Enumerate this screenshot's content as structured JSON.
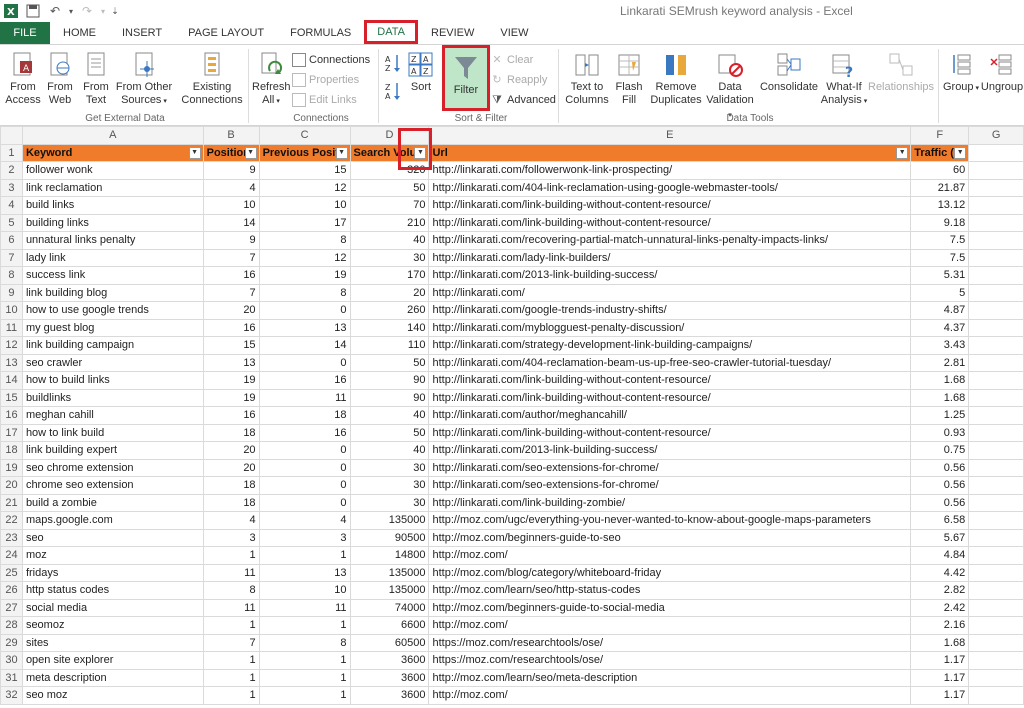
{
  "window": {
    "title": "Linkarati SEMrush keyword analysis - Excel"
  },
  "tabs": [
    "FILE",
    "HOME",
    "INSERT",
    "PAGE LAYOUT",
    "FORMULAS",
    "DATA",
    "REVIEW",
    "VIEW"
  ],
  "active_tab": "DATA",
  "ribbon": {
    "get_external": {
      "label": "Get External Data",
      "from_access": "From\nAccess",
      "from_web": "From\nWeb",
      "from_text": "From\nText",
      "from_other": "From Other\nSources",
      "existing": "Existing\nConnections"
    },
    "connections": {
      "label": "Connections",
      "refresh": "Refresh\nAll",
      "connections": "Connections",
      "properties": "Properties",
      "edit_links": "Edit Links"
    },
    "sort_filter": {
      "label": "Sort & Filter",
      "sort": "Sort",
      "filter": "Filter",
      "clear": "Clear",
      "reapply": "Reapply",
      "advanced": "Advanced"
    },
    "data_tools": {
      "label": "Data Tools",
      "text_to_columns": "Text to\nColumns",
      "flash_fill": "Flash\nFill",
      "remove_duplicates": "Remove\nDuplicates",
      "data_validation": "Data\nValidation",
      "consolidate": "Consolidate",
      "what_if": "What-If\nAnalysis",
      "relationships": "Relationships"
    },
    "outline": {
      "group": "Group",
      "ungroup": "Ungroup"
    }
  },
  "sheet": {
    "columns": [
      "A",
      "B",
      "C",
      "D",
      "E",
      "F",
      "G"
    ],
    "headers": [
      "Keyword",
      "Position",
      "Previous Positi",
      "Search Volu",
      "Url",
      "Traffic (%"
    ],
    "rows": [
      [
        "follower wonk",
        "9",
        "15",
        "320",
        "http://linkarati.com/followerwonk-link-prospecting/",
        "60"
      ],
      [
        "link reclamation",
        "4",
        "12",
        "50",
        "http://linkarati.com/404-link-reclamation-using-google-webmaster-tools/",
        "21.87"
      ],
      [
        "build links",
        "10",
        "10",
        "70",
        "http://linkarati.com/link-building-without-content-resource/",
        "13.12"
      ],
      [
        "building links",
        "14",
        "17",
        "210",
        "http://linkarati.com/link-building-without-content-resource/",
        "9.18"
      ],
      [
        "unnatural links penalty",
        "9",
        "8",
        "40",
        "http://linkarati.com/recovering-partial-match-unnatural-links-penalty-impacts-links/",
        "7.5"
      ],
      [
        "lady link",
        "7",
        "12",
        "30",
        "http://linkarati.com/lady-link-builders/",
        "7.5"
      ],
      [
        "success link",
        "16",
        "19",
        "170",
        "http://linkarati.com/2013-link-building-success/",
        "5.31"
      ],
      [
        "link building blog",
        "7",
        "8",
        "20",
        "http://linkarati.com/",
        "5"
      ],
      [
        "how to use google trends",
        "20",
        "0",
        "260",
        "http://linkarati.com/google-trends-industry-shifts/",
        "4.87"
      ],
      [
        "my guest blog",
        "16",
        "13",
        "140",
        "http://linkarati.com/myblogguest-penalty-discussion/",
        "4.37"
      ],
      [
        "link building campaign",
        "15",
        "14",
        "110",
        "http://linkarati.com/strategy-development-link-building-campaigns/",
        "3.43"
      ],
      [
        "seo crawler",
        "13",
        "0",
        "50",
        "http://linkarati.com/404-reclamation-beam-us-up-free-seo-crawler-tutorial-tuesday/",
        "2.81"
      ],
      [
        "how to build links",
        "19",
        "16",
        "90",
        "http://linkarati.com/link-building-without-content-resource/",
        "1.68"
      ],
      [
        "buildlinks",
        "19",
        "11",
        "90",
        "http://linkarati.com/link-building-without-content-resource/",
        "1.68"
      ],
      [
        "meghan cahill",
        "16",
        "18",
        "40",
        "http://linkarati.com/author/meghancahill/",
        "1.25"
      ],
      [
        "how to link build",
        "18",
        "16",
        "50",
        "http://linkarati.com/link-building-without-content-resource/",
        "0.93"
      ],
      [
        "link building expert",
        "20",
        "0",
        "40",
        "http://linkarati.com/2013-link-building-success/",
        "0.75"
      ],
      [
        "seo chrome extension",
        "20",
        "0",
        "30",
        "http://linkarati.com/seo-extensions-for-chrome/",
        "0.56"
      ],
      [
        "chrome seo extension",
        "18",
        "0",
        "30",
        "http://linkarati.com/seo-extensions-for-chrome/",
        "0.56"
      ],
      [
        "build a zombie",
        "18",
        "0",
        "30",
        "http://linkarati.com/link-building-zombie/",
        "0.56"
      ],
      [
        "maps.google.com",
        "4",
        "4",
        "135000",
        "http://moz.com/ugc/everything-you-never-wanted-to-know-about-google-maps-parameters",
        "6.58"
      ],
      [
        "seo",
        "3",
        "3",
        "90500",
        "http://moz.com/beginners-guide-to-seo",
        "5.67"
      ],
      [
        "moz",
        "1",
        "1",
        "14800",
        "http://moz.com/",
        "4.84"
      ],
      [
        "fridays",
        "11",
        "13",
        "135000",
        "http://moz.com/blog/category/whiteboard-friday",
        "4.42"
      ],
      [
        "http status codes",
        "8",
        "10",
        "135000",
        "http://moz.com/learn/seo/http-status-codes",
        "2.82"
      ],
      [
        "social media",
        "11",
        "11",
        "74000",
        "http://moz.com/beginners-guide-to-social-media",
        "2.42"
      ],
      [
        "seomoz",
        "1",
        "1",
        "6600",
        "http://moz.com/",
        "2.16"
      ],
      [
        "sites",
        "7",
        "8",
        "60500",
        "https://moz.com/researchtools/ose/",
        "1.68"
      ],
      [
        "open site explorer",
        "1",
        "1",
        "3600",
        "https://moz.com/researchtools/ose/",
        "1.17"
      ],
      [
        "meta description",
        "1",
        "1",
        "3600",
        "http://moz.com/learn/seo/meta-description",
        "1.17"
      ],
      [
        "seo moz",
        "1",
        "1",
        "3600",
        "http://moz.com/",
        "1.17"
      ]
    ]
  }
}
